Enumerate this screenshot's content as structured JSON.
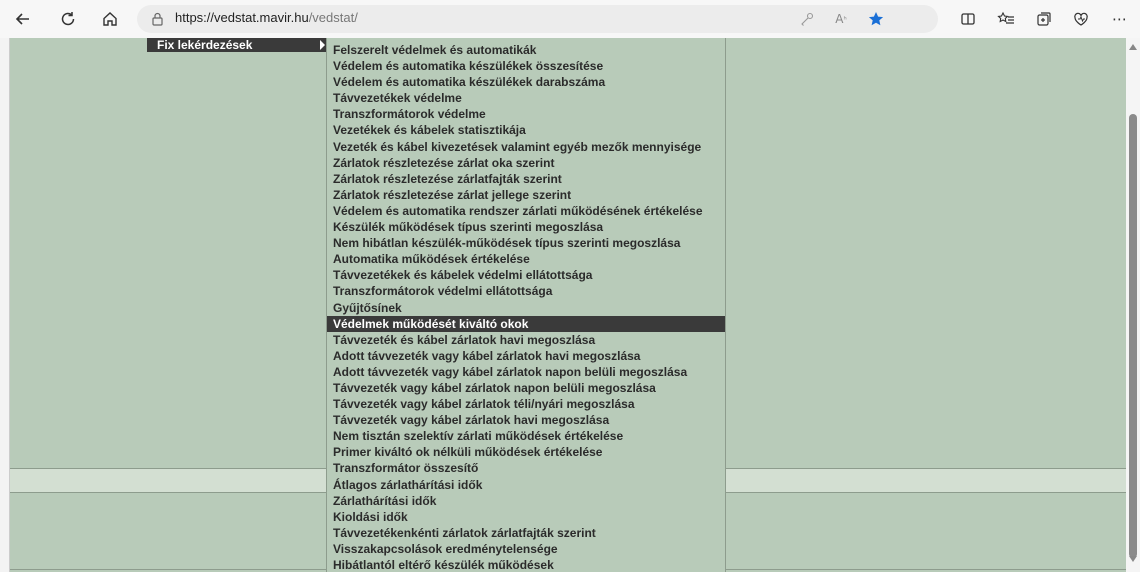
{
  "browser": {
    "url_host": "https://vedstat.mavir.hu",
    "url_path": "/vedstat/",
    "icons": [
      "back-icon",
      "refresh-icon",
      "home-icon",
      "lock-icon",
      "key-icon",
      "read-aloud-icon",
      "favorite-star-icon",
      "split-screen-icon",
      "favorites-list-icon",
      "collections-icon",
      "extensions-icon",
      "more-icon"
    ],
    "accent": "#1a6fd6"
  },
  "menu": {
    "title": "Fix lekérdezések",
    "items": [
      {
        "label": "Felszerelt védelmek és automatikák"
      },
      {
        "label": "Védelem és automatika készülékek összesítése"
      },
      {
        "label": "Védelem és automatika készülékek darabszáma"
      },
      {
        "label": "Távvezetékek védelme"
      },
      {
        "label": "Transzformátorok védelme"
      },
      {
        "label": "Vezetékek és kábelek statisztikája"
      },
      {
        "label": "Vezeték és kábel kivezetések valamint egyéb mezők mennyisége"
      },
      {
        "label": "Zárlatok részletezése zárlat oka szerint"
      },
      {
        "label": "Zárlatok részletezése zárlatfajták szerint"
      },
      {
        "label": "Zárlatok részletezése zárlat jellege szerint"
      },
      {
        "label": "Védelem és automatika rendszer zárlati működésének értékelése"
      },
      {
        "label": "Készülék működések típus szerinti megoszlása"
      },
      {
        "label": "Nem hibátlan készülék-működések típus szerinti megoszlása"
      },
      {
        "label": "Automatika működések értékelése"
      },
      {
        "label": "Távvezetékek és kábelek védelmi ellátottsága"
      },
      {
        "label": "Transzformátorok védelmi ellátottsága"
      },
      {
        "label": "Gyűjtősínek"
      },
      {
        "label": "Védelmek működését kiváltó okok",
        "active": true
      },
      {
        "label": "Távvezeték és kábel zárlatok havi megoszlása"
      },
      {
        "label": "Adott távvezeték vagy kábel zárlatok havi megoszlása"
      },
      {
        "label": "Adott távvezeték vagy kábel zárlatok napon belüli megoszlása"
      },
      {
        "label": "Távvezeték vagy kábel zárlatok napon belüli megoszlása"
      },
      {
        "label": "Távvezeték vagy kábel zárlatok téli/nyári megoszlása"
      },
      {
        "label": "Távvezeték vagy kábel zárlatok havi megoszlása"
      },
      {
        "label": "Nem tisztán szelektív zárlati működések értékelése"
      },
      {
        "label": "Primer kiváltó ok nélküli működések értékelése"
      },
      {
        "label": "Transzformátor összesítő"
      },
      {
        "label": "Átlagos zárlathárítási idők"
      },
      {
        "label": "Zárlathárítási idők"
      },
      {
        "label": "Kioldási idők"
      },
      {
        "label": "Távvezetékenkénti zárlatok zárlatfajták szerint"
      },
      {
        "label": "Visszakapcsolások eredménytelensége"
      },
      {
        "label": "Hibátlantól eltérő készülék működések"
      }
    ]
  },
  "colors": {
    "page_bg": "#b8cbb9",
    "band_bg": "#d3dfd2",
    "menu_active_bg": "#3a3a3a"
  }
}
